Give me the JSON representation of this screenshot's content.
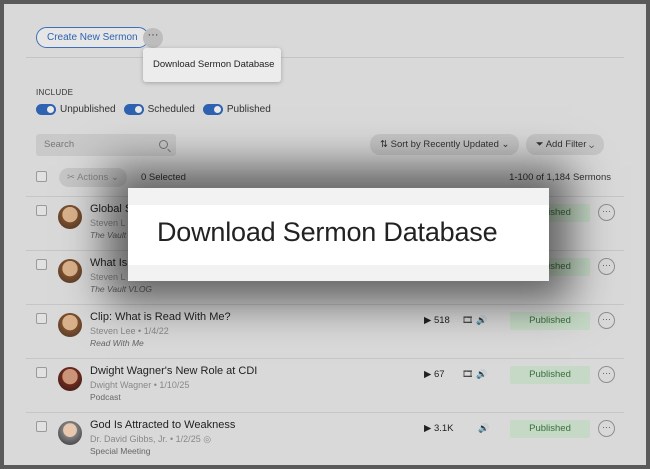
{
  "header": {
    "create_button": "Create New Sermon",
    "more_button": "···",
    "dropdown_item": "Download Sermon Database"
  },
  "filters": {
    "include_label": "INCLUDE",
    "toggles": [
      {
        "label": "Unpublished",
        "on": true
      },
      {
        "label": "Scheduled",
        "on": true
      },
      {
        "label": "Published",
        "on": true
      }
    ],
    "search_placeholder": "Search",
    "sort_label": "Sort by Recently Updated",
    "filter_label": "Add Filter"
  },
  "list": {
    "actions_label": "Actions",
    "selected_text": "0 Selected",
    "count_text": "1-100 of 1,184 Sermons",
    "rows": [
      {
        "title": "Global S",
        "meta": "Steven L",
        "series": "The Vault",
        "status": "Published"
      },
      {
        "title": "What Is",
        "meta": "Steven L",
        "series": "The Vault VLOG",
        "status": "Published"
      },
      {
        "title": "Clip: What is Read With Me?",
        "meta": "Steven Lee • 1/4/22",
        "series": "Read With Me",
        "plays": "518",
        "status": "Published"
      },
      {
        "title": "Dwight Wagner's New Role at CDI",
        "meta": "Dwight Wagner • 1/10/25",
        "series": "Podcast",
        "plays": "67",
        "status": "Published"
      },
      {
        "title": "God Is Attracted to Weakness",
        "meta": "Dr. David Gibbs, Jr. • 1/2/25",
        "series": "Special Meeting",
        "plays": "3.1K",
        "status": "Published"
      }
    ]
  },
  "zoom_callout": {
    "text": "Download Sermon Database"
  },
  "colors": {
    "accent": "#2f62b0",
    "published_bg": "#c6d9c6",
    "published_text": "#35703a"
  }
}
